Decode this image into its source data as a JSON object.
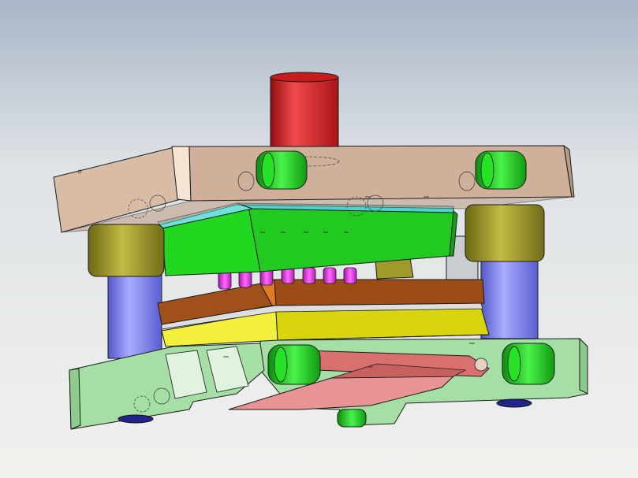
{
  "scene": {
    "background": {
      "top": "#a9b6c7",
      "mid": "#dfe3e6",
      "bottom": "#f1f1ee"
    },
    "parts": [
      "punch-shank",
      "top-die-plate",
      "upper-guide-bushing-left",
      "upper-guide-bushing-right",
      "guide-post-left",
      "guide-post-right",
      "backing-plate",
      "punch-holder-plate",
      "pierce-punch-pins",
      "stripper-plate",
      "die-plate",
      "bottom-die-shoe",
      "strip-workpiece",
      "cap-screw-heads"
    ],
    "colors": {
      "punch_shank": "#d8262a",
      "top_plate": "#cfb19b",
      "bushing": "#a09a2c",
      "guide_post": "#7c80ee",
      "backing_plate": "#4fd3cf",
      "punch_holder": "#21d421",
      "pins": "#e82ee8",
      "stripper": "#9c4c14",
      "die_plate": "#d8d40e",
      "bottom_plate": "#a6dfa6",
      "strip": "#d96f6f",
      "screw": "#1fd81f",
      "outline": "#1b1b1b"
    }
  }
}
